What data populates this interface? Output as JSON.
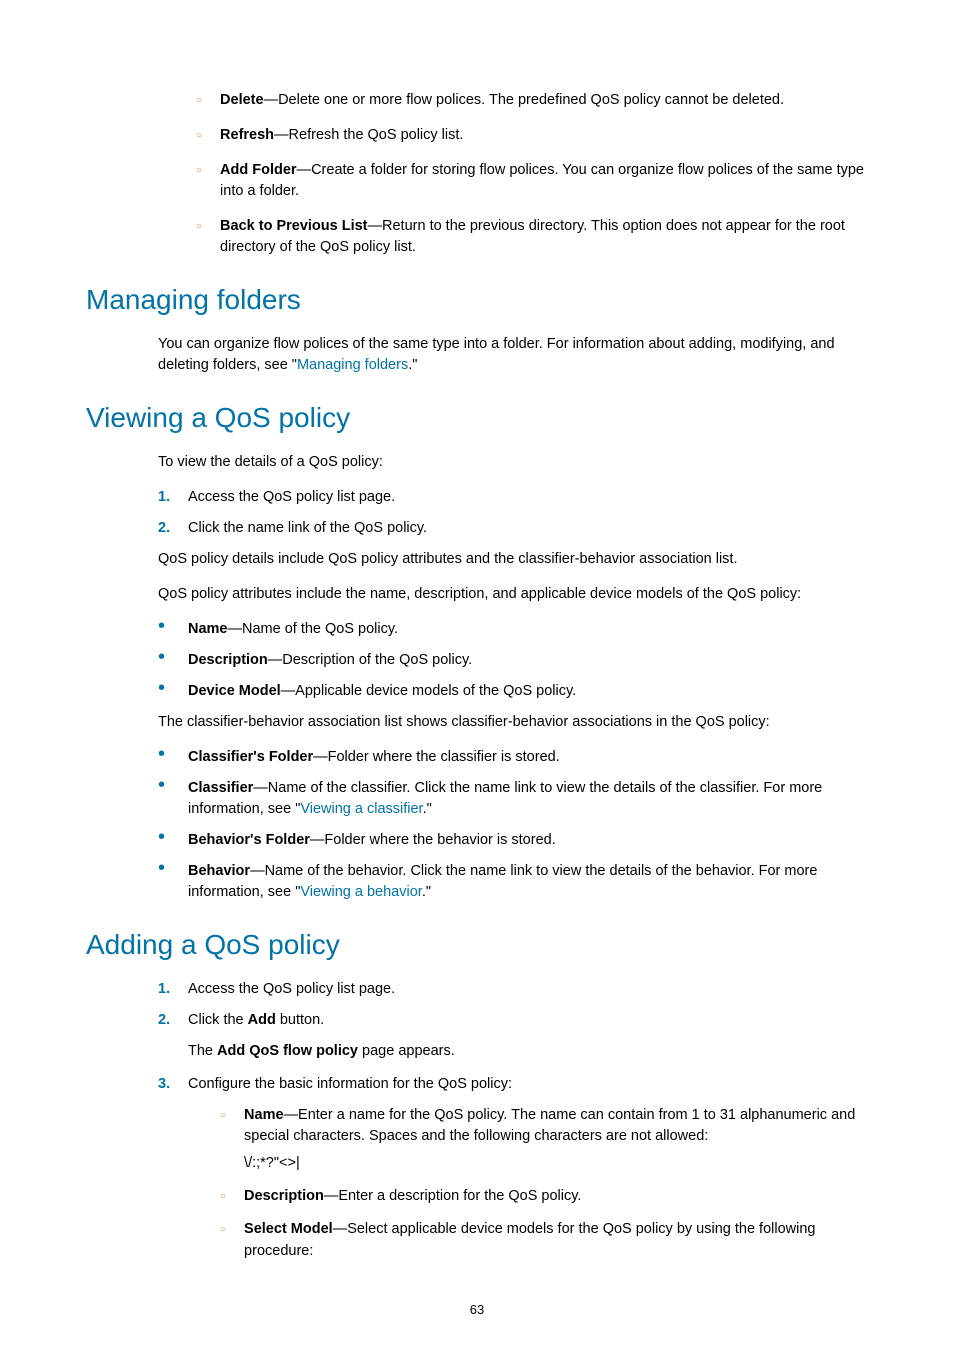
{
  "top_sub_list": [
    {
      "term": "Delete",
      "text": "—Delete one or more flow polices. The predefined QoS policy cannot be deleted."
    },
    {
      "term": "Refresh",
      "text": "—Refresh the QoS policy list."
    },
    {
      "term": "Add Folder",
      "text": "—Create a folder for storing flow polices. You can organize flow polices of the same type into a folder."
    },
    {
      "term": "Back to Previous List",
      "text": "—Return to the previous directory. This option does not appear for the root directory of the QoS policy list."
    }
  ],
  "managing_folders": {
    "heading": "Managing folders",
    "para_pre": "You can organize flow polices of the same type into a folder. For information about adding, modifying, and deleting folders, see \"",
    "link": "Managing folders",
    "para_post": ".\""
  },
  "viewing": {
    "heading": "Viewing a QoS policy",
    "intro": "To view the details of a QoS policy:",
    "steps": [
      "Access the QoS policy list page.",
      "Click the name link of the QoS policy."
    ],
    "para1": "QoS policy details include QoS policy attributes and the classifier-behavior association list.",
    "para2": "QoS policy attributes include the name, description, and applicable device models of the QoS policy:",
    "attrs": [
      {
        "term": "Name",
        "text": "—Name of the QoS policy."
      },
      {
        "term": "Description",
        "text": "—Description of the QoS policy."
      },
      {
        "term": "Device Model",
        "text": "—Applicable device models of the QoS policy."
      }
    ],
    "para3": "The classifier-behavior association list shows classifier-behavior associations in the QoS policy:",
    "assoc": [
      {
        "term": "Classifier's Folder",
        "text": "—Folder where the classifier is stored.",
        "link": null
      },
      {
        "term": "Classifier",
        "text": "—Name of the classifier. Click the name link to view the details of the classifier. For more information, see \"",
        "link": "Viewing a classifier",
        "post": ".\""
      },
      {
        "term": "Behavior's Folder",
        "text": "—Folder where the behavior is stored.",
        "link": null
      },
      {
        "term": "Behavior",
        "text": "—Name of the behavior. Click the name link to view the details of the behavior. For more information, see \"",
        "link": "Viewing a behavior",
        "post": ".\""
      }
    ]
  },
  "adding": {
    "heading": "Adding a QoS policy",
    "step1": "Access the QoS policy list page.",
    "step2_pre": "Click the ",
    "step2_bold": "Add",
    "step2_post": " button.",
    "step2_body_pre": "The ",
    "step2_body_bold": "Add QoS flow policy",
    "step2_body_post": " page appears.",
    "step3": "Configure the basic information for the QoS policy:",
    "step3_sub": [
      {
        "term": "Name",
        "text": "—Enter a name for the QoS policy. The name can contain from 1 to 31 alphanumeric and special characters. Spaces and the following characters are not allowed:",
        "extra": "\\/:;*?\"<>|"
      },
      {
        "term": "Description",
        "text": "—Enter a description for the QoS policy."
      },
      {
        "term": "Select Model",
        "text": "—Select applicable device models for the QoS policy by using the following procedure:"
      }
    ]
  },
  "page_number": "63"
}
